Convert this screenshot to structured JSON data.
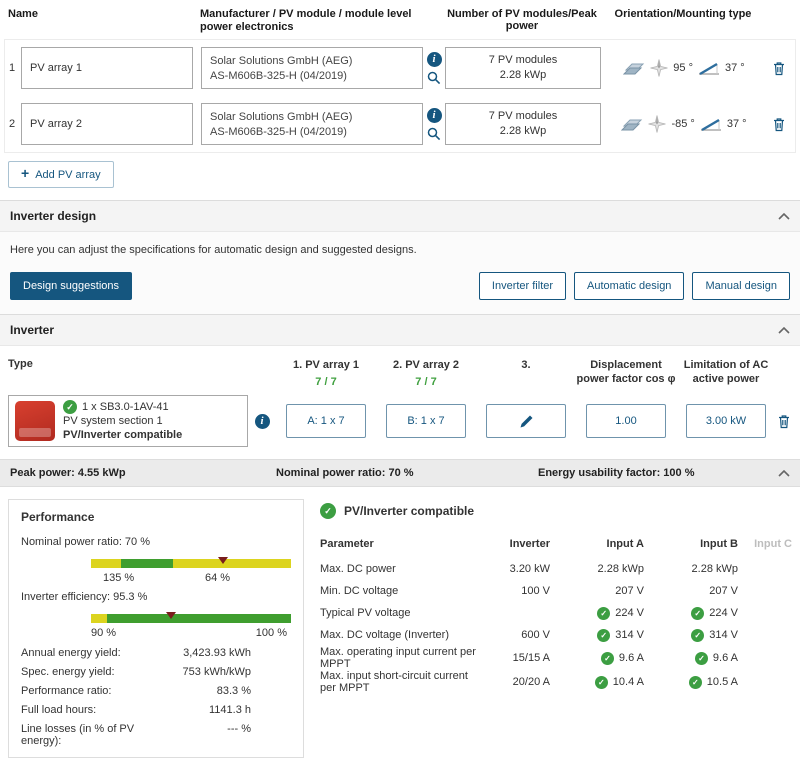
{
  "pv_table": {
    "headers": {
      "name": "Name",
      "manufacturer": "Manufacturer / PV module / module level power electronics",
      "modules": "Number of PV modules/Peak power",
      "orientation": "Orientation/Mounting type"
    },
    "rows": [
      {
        "index": "1",
        "name": "PV array 1",
        "manufacturer_line1": "Solar Solutions GmbH (AEG)",
        "manufacturer_line2": "AS-M606B-325-H (04/2019)",
        "module_count": "7 PV modules",
        "peak_power": "2.28 kWp",
        "azimuth": "95 °",
        "tilt": "37 °"
      },
      {
        "index": "2",
        "name": "PV array 2",
        "manufacturer_line1": "Solar Solutions GmbH (AEG)",
        "manufacturer_line2": "AS-M606B-325-H (04/2019)",
        "module_count": "7 PV modules",
        "peak_power": "2.28 kWp",
        "azimuth": "-85 °",
        "tilt": "37 °"
      }
    ],
    "add_button": "Add PV array"
  },
  "inverter_design": {
    "title": "Inverter design",
    "description": "Here you can adjust the specifications for automatic design and suggested designs.",
    "design_suggestions": "Design suggestions",
    "inverter_filter": "Inverter filter",
    "automatic_design": "Automatic design",
    "manual_design": "Manual design"
  },
  "inverter": {
    "title": "Inverter",
    "headers": {
      "type": "Type",
      "array1": "1. PV array 1",
      "array1_ratio": "7 / 7",
      "array2": "2. PV array 2",
      "array2_ratio": "7 / 7",
      "array3": "3.",
      "cos_phi": "Displacement power factor cos φ",
      "ac_limit": "Limitation of AC active power"
    },
    "row": {
      "name": "1 x SB3.0-1AV-41",
      "section": "PV system section 1",
      "status": "PV/Inverter compatible",
      "input_a": "A: 1 x 7",
      "input_b": "B: 1 x 7",
      "cos_phi": "1.00",
      "ac_limit": "3.00 kW"
    }
  },
  "summary": {
    "peak_power": "Peak power: 4.55 kWp",
    "nominal_power_ratio": "Nominal power ratio: 70 %",
    "energy_usability": "Energy usability factor: 100 %"
  },
  "performance": {
    "title": "Performance",
    "npr_label": "Nominal power ratio: 70 %",
    "npr_tick_left": "135 %",
    "npr_tick_right": "64 %",
    "eff_label": "Inverter efficiency: 95.3 %",
    "eff_tick_left": "90 %",
    "eff_tick_right": "100 %",
    "metrics": [
      {
        "label": "Annual energy yield:",
        "value": "3,423.93 kWh"
      },
      {
        "label": "Spec. energy yield:",
        "value": "753 kWh/kWp"
      },
      {
        "label": "Performance ratio:",
        "value": "83.3 %"
      },
      {
        "label": "Full load hours:",
        "value": "1141.3 h"
      },
      {
        "label": "Line losses (in % of PV energy):",
        "value": "--- %"
      }
    ]
  },
  "compat": {
    "title": "PV/Inverter compatible",
    "headers": {
      "parameter": "Parameter",
      "inverter": "Inverter",
      "input_a": "Input A",
      "input_b": "Input B",
      "input_c": "Input C"
    },
    "rows": [
      {
        "parameter": "Max. DC power",
        "inverter": "3.20 kW",
        "a": "2.28 kWp",
        "b": "2.28 kWp"
      },
      {
        "parameter": "Min. DC voltage",
        "inverter": "100 V",
        "a": "207 V",
        "b": "207 V"
      },
      {
        "parameter": "Typical PV voltage",
        "inverter": "",
        "a": "224 V",
        "b": "224 V"
      },
      {
        "parameter": "Max. DC voltage (Inverter)",
        "inverter": "600 V",
        "a": "314 V",
        "b": "314 V"
      },
      {
        "parameter": "Max. operating input current per MPPT",
        "inverter": "15/15 A",
        "a": "9.6 A",
        "b": "9.6 A"
      },
      {
        "parameter": "Max. input short-circuit current per MPPT",
        "inverter": "20/20 A",
        "a": "10.4 A",
        "b": "10.5 A"
      }
    ]
  },
  "colors": {
    "accent": "#15567f",
    "green": "#3c9e42",
    "bar_yellow": "#dcd41f",
    "bar_green": "#3f9e2f",
    "marker_red": "#7a1d1d"
  }
}
